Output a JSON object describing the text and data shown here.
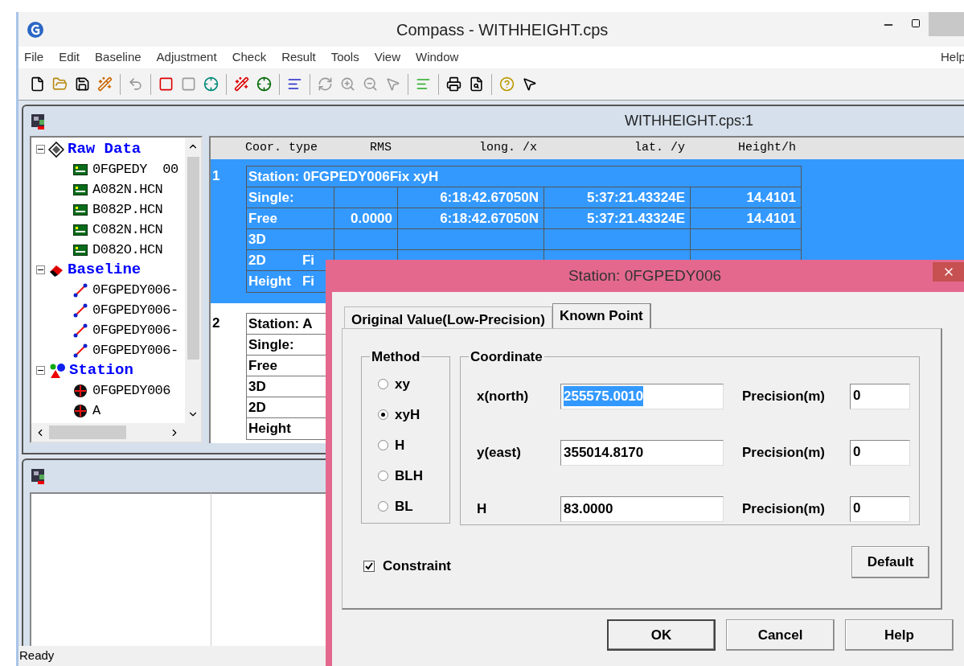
{
  "window": {
    "title": "Compass - WITHHEIGHT.cps"
  },
  "menu": [
    "File",
    "Edit",
    "Baseline",
    "Adjustment",
    "Check",
    "Result",
    "Tools",
    "View",
    "Window",
    "Help"
  ],
  "child_window": {
    "title": "WITHHEIGHT.cps:1"
  },
  "tree": [
    {
      "label": "Raw Data",
      "expanded": true,
      "children": [
        {
          "label": "0FGPEDY  00",
          "kind": "raw"
        },
        {
          "label": "A082N.HCN",
          "kind": "raw"
        },
        {
          "label": "B082P.HCN",
          "kind": "raw"
        },
        {
          "label": "C082N.HCN",
          "kind": "raw"
        },
        {
          "label": "D082O.HCN",
          "kind": "raw"
        }
      ]
    },
    {
      "label": "Baseline",
      "expanded": true,
      "children": [
        {
          "label": "0FGPEDY006-",
          "kind": "baseline"
        },
        {
          "label": "0FGPEDY006-",
          "kind": "baseline"
        },
        {
          "label": "0FGPEDY006-",
          "kind": "baseline"
        },
        {
          "label": "0FGPEDY006-",
          "kind": "baseline"
        }
      ]
    },
    {
      "label": "Station",
      "expanded": true,
      "children": [
        {
          "label": "0FGPEDY006",
          "kind": "station"
        },
        {
          "label": "A",
          "kind": "station"
        }
      ]
    }
  ],
  "grid": {
    "columns": [
      "Coor. type",
      "RMS",
      "long. /x",
      "lat. /y",
      "Height/h"
    ],
    "records": [
      {
        "number": "1",
        "selected": true,
        "title": "Station: 0FGPEDY006Fix xyH",
        "rows": [
          {
            "label": "Single:",
            "cells": [
              "",
              "6:18:42.67050N",
              "5:37:21.43324E",
              "14.4101"
            ]
          },
          {
            "label": "Free",
            "cells": [
              "0.0000",
              "6:18:42.67050N",
              "5:37:21.43324E",
              "14.4101"
            ]
          },
          {
            "label": "3D",
            "cells": [
              "",
              "",
              "",
              ""
            ]
          },
          {
            "label": "2D",
            "note": "Fi",
            "cells": [
              "",
              "",
              "",
              ""
            ]
          },
          {
            "label": "Height",
            "note": "Fi",
            "cells": [
              "",
              "",
              "",
              ""
            ]
          }
        ]
      },
      {
        "number": "2",
        "selected": false,
        "title": "Station: A",
        "rows": [
          {
            "label": "Single:",
            "cells": [
              "",
              "",
              "",
              ""
            ]
          },
          {
            "label": "Free",
            "cells": [
              "",
              "",
              "",
              ""
            ]
          },
          {
            "label": "3D",
            "cells": [
              "",
              "",
              "",
              ""
            ]
          },
          {
            "label": "2D",
            "cells": [
              "",
              "",
              "",
              ""
            ]
          },
          {
            "label": "Height",
            "cells": [
              "",
              "",
              "",
              ""
            ]
          }
        ]
      }
    ]
  },
  "status_bar": "Ready",
  "dialog": {
    "title": "Station: 0FGPEDY006",
    "tabs": [
      {
        "label": "Original Value(Low-Precision)",
        "selected": false
      },
      {
        "label": "Known Point",
        "selected": true
      }
    ],
    "method": {
      "legend": "Method",
      "options": [
        {
          "label": "xy",
          "selected": false
        },
        {
          "label": "xyH",
          "selected": true
        },
        {
          "label": "H",
          "selected": false
        },
        {
          "label": "BLH",
          "selected": false
        },
        {
          "label": "BL",
          "selected": false
        }
      ]
    },
    "coordinate": {
      "legend": "Coordinate",
      "rows": [
        {
          "label": "x(north)",
          "value": "255575.0010",
          "text_selected": true,
          "precision_label": "Precision(m)",
          "precision": "0"
        },
        {
          "label": "y(east)",
          "value": "355014.8170",
          "text_selected": false,
          "precision_label": "Precision(m)",
          "precision": "0"
        },
        {
          "label": "H",
          "value": "83.0000",
          "text_selected": false,
          "precision_label": "Precision(m)",
          "precision": "0"
        }
      ]
    },
    "constraint": {
      "label": "Constraint",
      "checked": true
    },
    "buttons": [
      {
        "label": "Default",
        "kind": "panel"
      },
      {
        "label": "OK",
        "kind": "default"
      },
      {
        "label": "Cancel",
        "kind": "normal"
      },
      {
        "label": "Help",
        "kind": "normal"
      }
    ]
  }
}
